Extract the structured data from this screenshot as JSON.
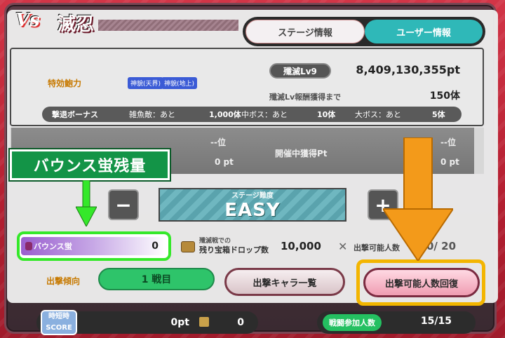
{
  "header": {
    "vs_logo": "Vs",
    "title": "滅忍",
    "tabs": [
      {
        "label": "ステージ情報"
      },
      {
        "label": "ユーザー情報"
      }
    ]
  },
  "stats": {
    "special_power_label": "特効鮑力",
    "chips": [
      "神貌(天界)",
      "神貌(地上)"
    ],
    "level_label": "殲滅Lv9",
    "points": "8,409,130,355pt",
    "next_reward_label": "殲滅Lv報酬獲得まで",
    "next_reward_value": "150体"
  },
  "bonus": {
    "label": "撃退ボーナス",
    "minor_label": "雑魚敵：あと",
    "minor_value": "1,000体",
    "mid_label": "中ボス：あと",
    "mid_value": "10体",
    "big_label": "大ボス：あと",
    "big_value": "5体"
  },
  "ranking": {
    "left_rank": "--位",
    "left_pt": "0 pt",
    "earned_label": "開催中獲得Pt",
    "right_rank": "--位",
    "right_pt": "0 pt"
  },
  "difficulty": {
    "minus": "−",
    "plus": "+",
    "label": "ステージ難度",
    "value": "EASY"
  },
  "annotation": {
    "bounce_title": "バウンス蛍残量"
  },
  "bounce": {
    "name": "バウンス蛍",
    "value": "0"
  },
  "chest": {
    "label_line1": "殲滅戦での",
    "label_line2": "残り宝箱ドロップ数",
    "value": "10,000"
  },
  "players": {
    "label": "出撃可能人数",
    "value": "0/ 20"
  },
  "sortie": {
    "label": "出撃傾向",
    "battle": "1 戦目",
    "char_list": "出撃キャラ一覧",
    "recover": "出撃可能人数回復"
  },
  "footer": {
    "score_line1": "時短時",
    "score_line2": "SCORE",
    "pt": "0pt",
    "count": "0",
    "participants_label": "戦闘参加人数",
    "participants_value": "15/15"
  },
  "colors": {
    "accent_green": "#35e82a",
    "accent_orange": "#f39a1a",
    "highlight_yellow": "#f3b500",
    "bg_red": "#c4283a"
  }
}
